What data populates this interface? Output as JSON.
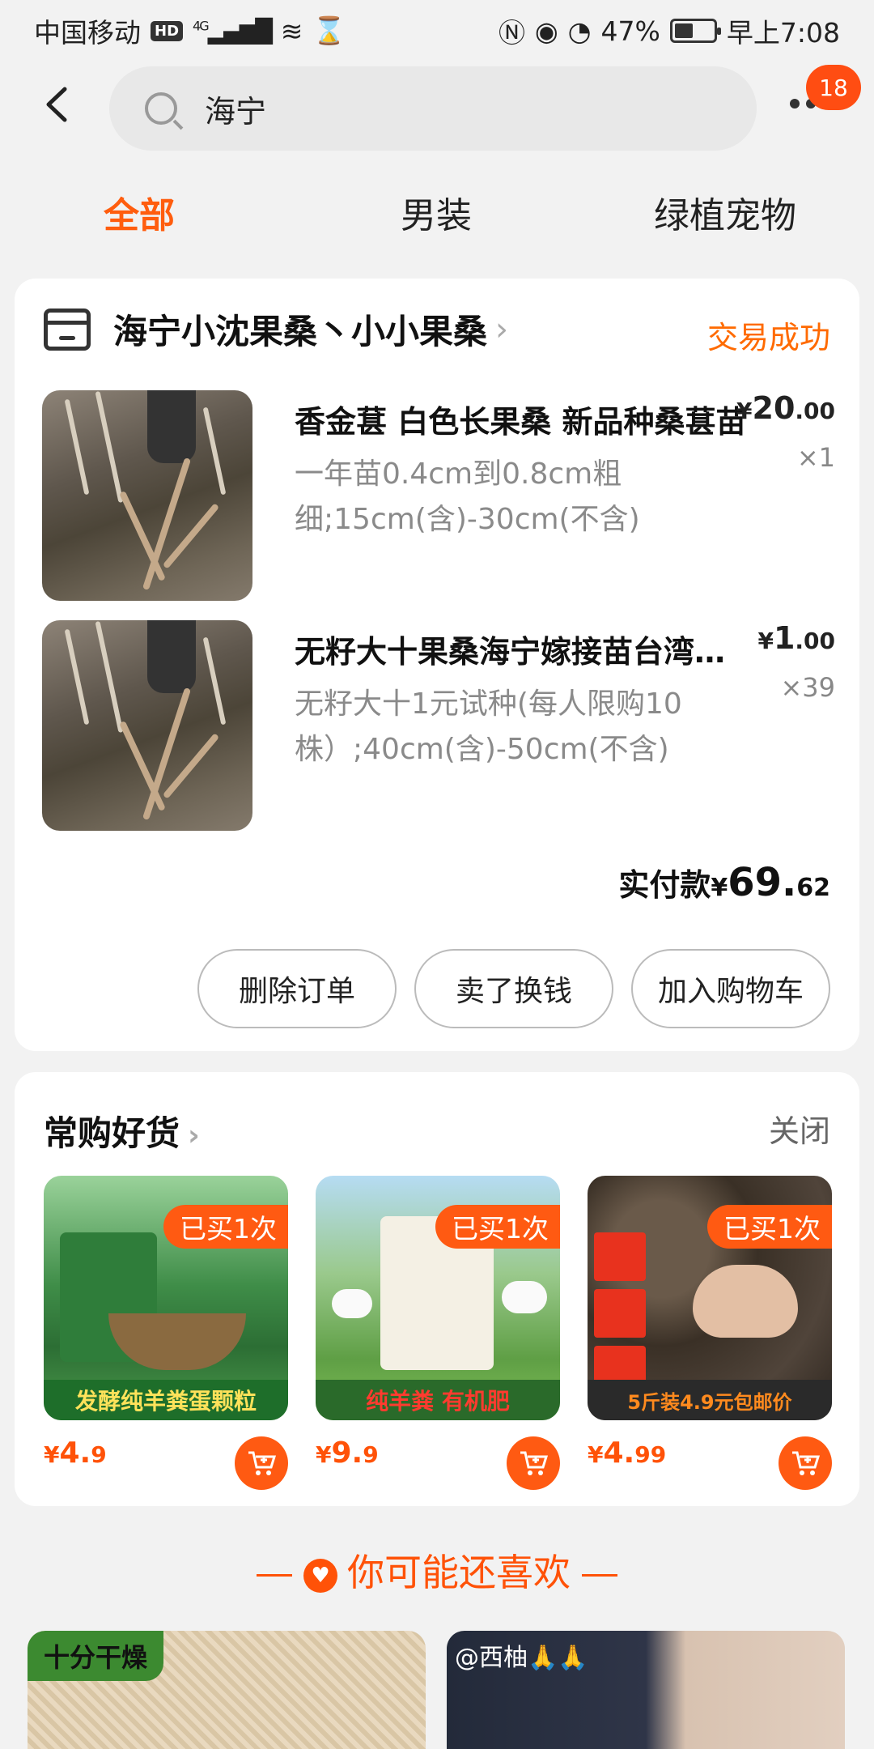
{
  "status_bar": {
    "carrier": "中国移动",
    "hd": "HD",
    "network": "4G",
    "battery_percent": "47%",
    "battery_level": 0.47,
    "time": "早上7:08"
  },
  "header": {
    "search_text": "海宁",
    "message_badge": "18"
  },
  "tabs": [
    {
      "label": "全部",
      "active": true
    },
    {
      "label": "男装",
      "active": false
    },
    {
      "label": "绿植宠物",
      "active": false
    }
  ],
  "order": {
    "shop_name": "海宁小沈果桑丶小小果桑",
    "status": "交易成功",
    "items": [
      {
        "name": "香金葚 白色长果桑 新品种桑葚苗",
        "sku": "一年苗0.4cm到0.8cm粗细;15cm(含)-30cm(不含)",
        "price_yen": "¥",
        "price_int": "20",
        "price_dec": ".00",
        "qty": "×1"
      },
      {
        "name": "无籽大十果桑海宁嫁接苗台湾长果桑",
        "sku": "无籽大十1元试种(每人限购10株）;40cm(含)-50cm(不含)",
        "price_yen": "¥",
        "price_int": "1",
        "price_dec": ".00",
        "qty": "×39"
      }
    ],
    "total_label": "实付款",
    "total_yen": "¥",
    "total_int": "69.",
    "total_dec": "62",
    "buttons": [
      "删除订单",
      "卖了换钱",
      "加入购物车"
    ]
  },
  "favorites": {
    "title": "常购好货",
    "close_label": "关闭",
    "products": [
      {
        "badge": "已买1次",
        "banner": "发酵纯羊粪蛋颗粒",
        "yen": "¥",
        "price_int": "4.",
        "price_dec": "9"
      },
      {
        "badge": "已买1次",
        "banner": "纯羊粪 有机肥",
        "yen": "¥",
        "price_int": "9.",
        "price_dec": "9"
      },
      {
        "badge": "已买1次",
        "banner": "5斤装4.9元包邮价",
        "yen": "¥",
        "price_int": "4.",
        "price_dec": "99"
      }
    ]
  },
  "recommend": {
    "title": "你可能还喜欢",
    "cards": [
      {
        "tag": "十分干燥"
      },
      {
        "tag": "@西柚🙏🙏"
      }
    ]
  }
}
